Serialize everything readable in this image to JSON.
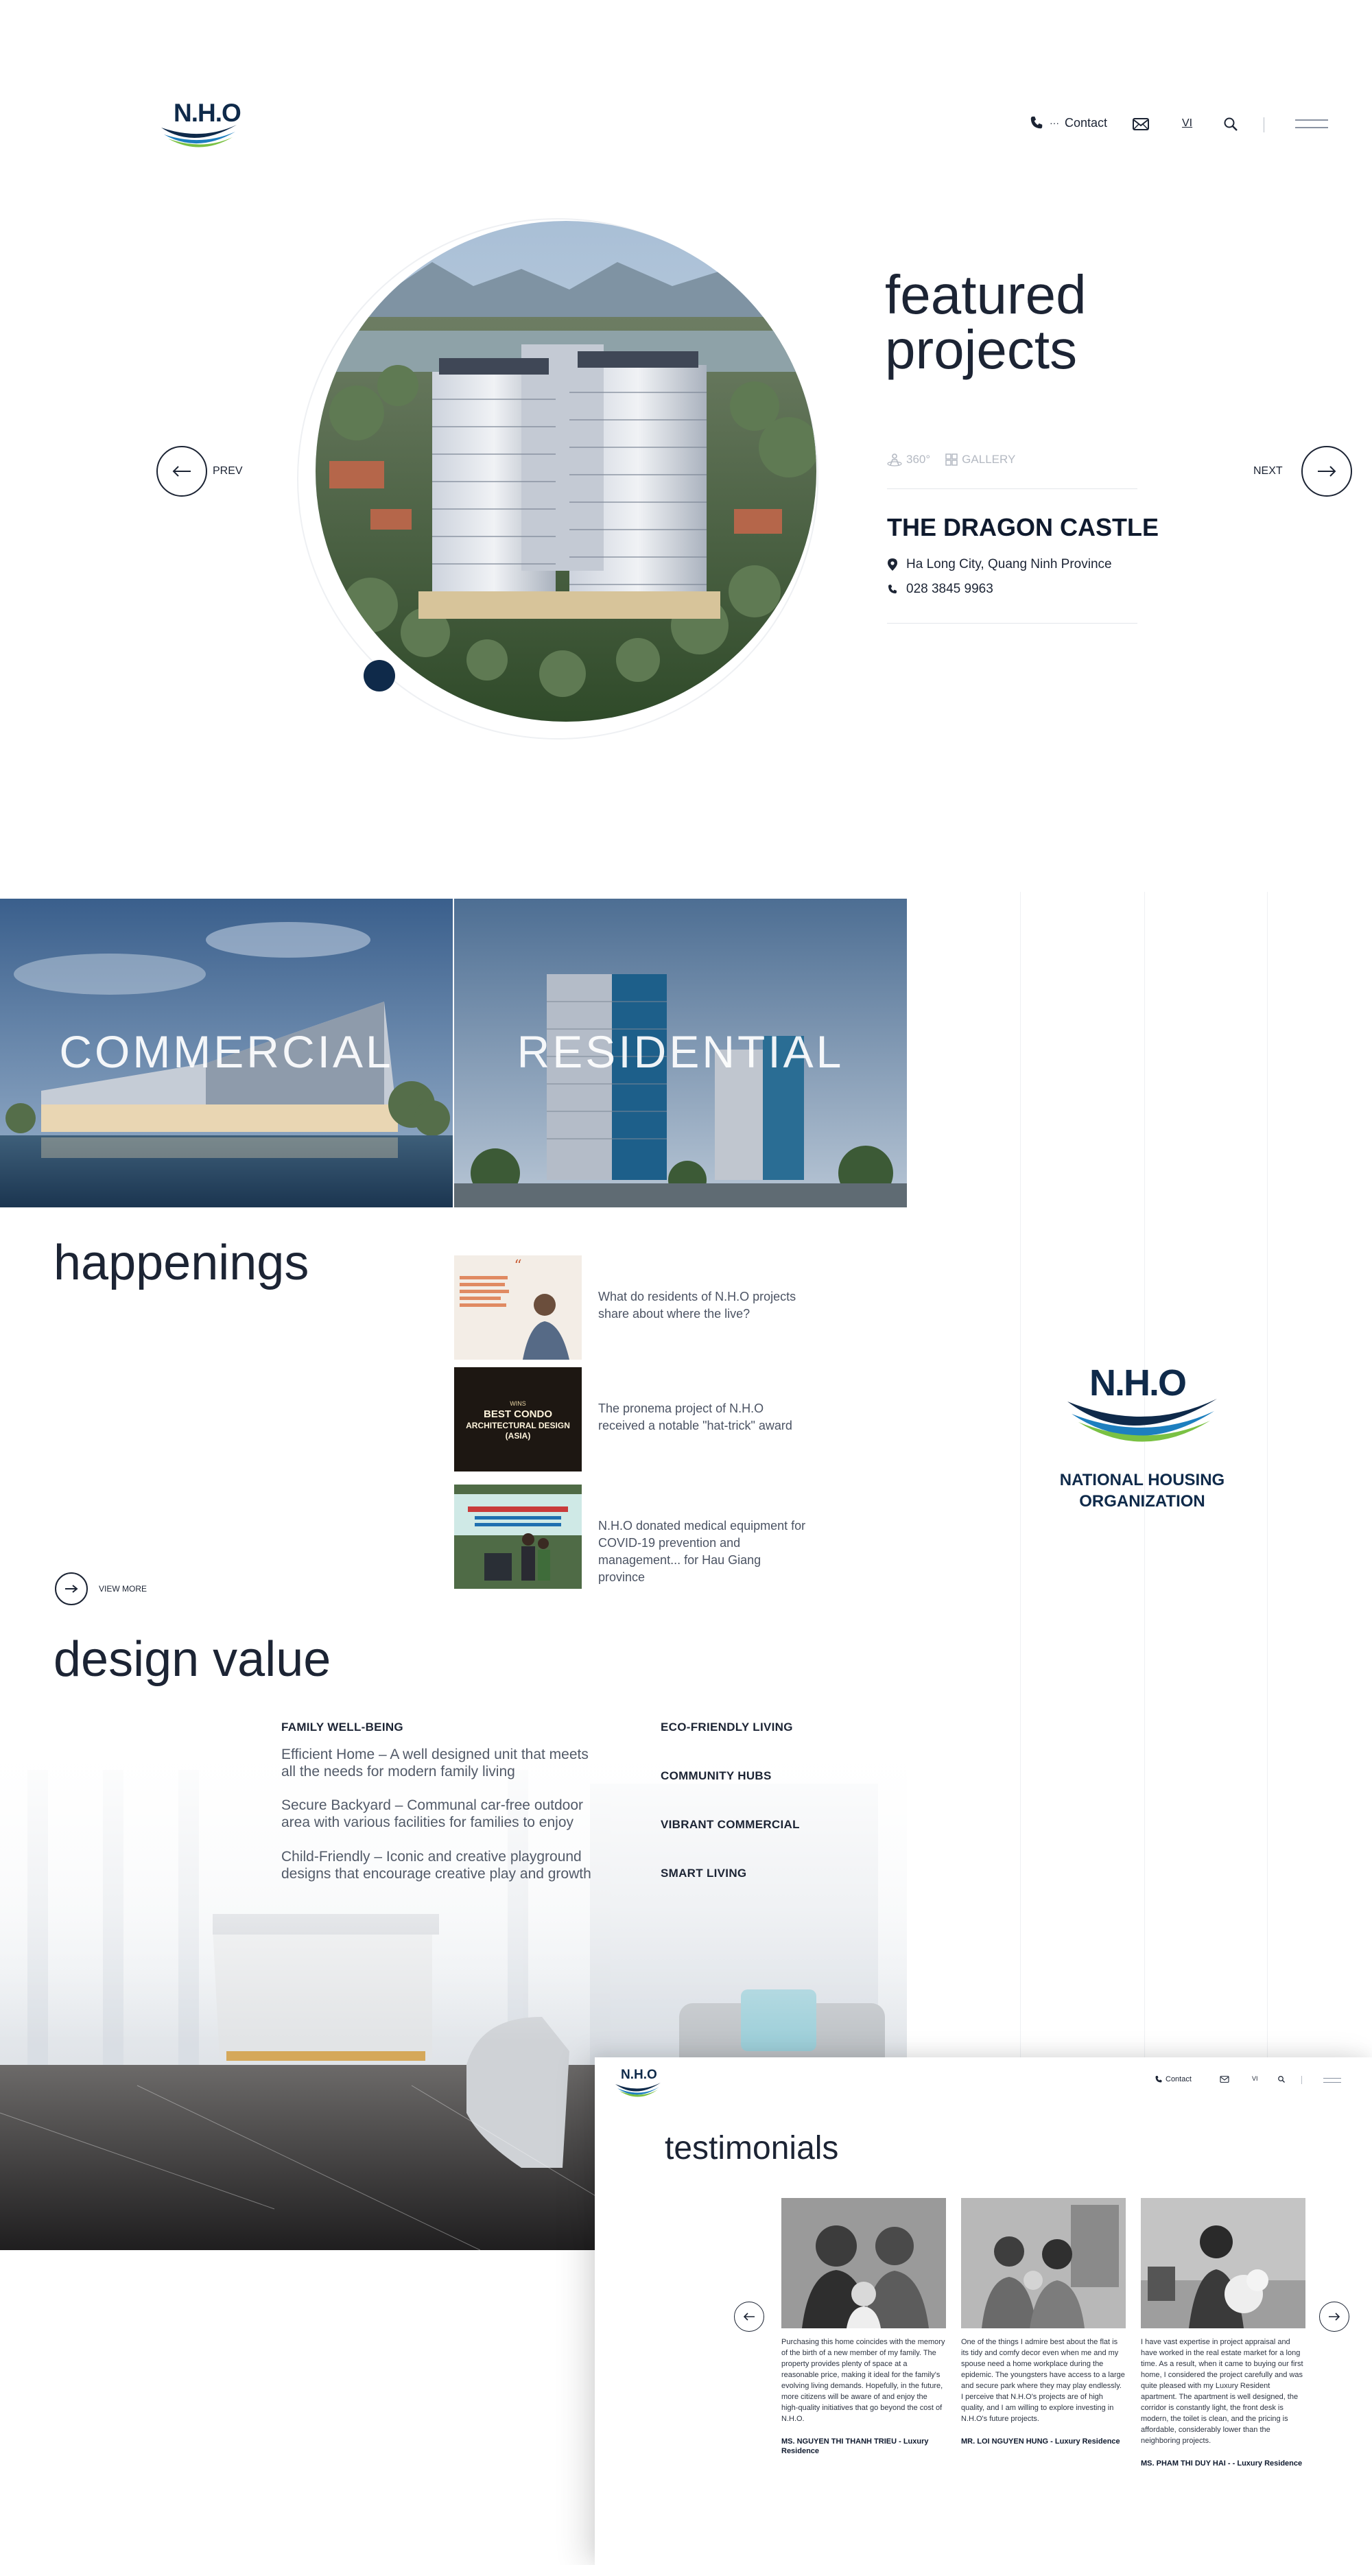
{
  "header": {
    "logo_text": "N.H.O",
    "contact_label": "Contact",
    "language": "VI"
  },
  "featured": {
    "title_line1": "featured",
    "title_line2": "projects",
    "prev_label": "PREV",
    "next_label": "NEXT",
    "tool_360": "360°",
    "tool_gallery": "GALLERY",
    "project_name": "THE DRAGON CASTLE",
    "location": "Ha Long City, Quang Ninh Province",
    "phone": "028 3845 9963"
  },
  "categories": [
    {
      "label": "COMMERCIAL"
    },
    {
      "label": "RESIDENTIAL"
    }
  ],
  "happenings": {
    "title": "happenings",
    "view_more": "VIEW MORE",
    "items": [
      {
        "text": "What do residents of N.H.O projects share about where the live?"
      },
      {
        "text": "The pronema project of N.H.O received a notable \"hat-trick\" award",
        "thumb_line1": "WINS",
        "thumb_line2": "BEST CONDO",
        "thumb_line3": "ARCHITECTURAL DESIGN",
        "thumb_line4": "(ASIA)"
      },
      {
        "text": "N.H.O donated medical equipment for COVID-19 prevention and management... for Hau Giang province"
      }
    ]
  },
  "org": {
    "logo_text": "N.H.O",
    "name_line1": "NATIONAL HOUSING",
    "name_line2": "ORGANIZATION"
  },
  "design_value": {
    "title": "design value",
    "left_heading": "FAMILY WELL-BEING",
    "points": [
      "Efficient Home – A well designed unit that meets all the needs for modern family living",
      "Secure Backyard – Communal car-free outdoor area with various facilities for families to enjoy",
      "Child-Friendly – Iconic and creative playground designs that encourage creative play and growth"
    ],
    "right_headings": [
      "ECO-FRIENDLY LIVING",
      "COMMUNITY HUBS",
      "VIBRANT COMMERCIAL",
      "SMART LIVING"
    ]
  },
  "testimonials": {
    "title": "testimonials",
    "nav_contact": "Contact",
    "nav_lang": "VI",
    "logo_text": "N.H.O",
    "items": [
      {
        "text": "Purchasing this home coincides with the memory of the birth of a new member of my family. The property provides plenty of space at a reasonable price, making it ideal for the family's evolving living demands. Hopefully, in the future, more citizens will be aware of and enjoy the high-quality initiatives that go beyond the cost of N.H.O.",
        "name": "MS. NGUYEN THI THANH TRIEU - Luxury Residence"
      },
      {
        "text": "One of the things I admire best about the flat is its tidy and comfy decor even when me and my spouse need a home workplace during the epidemic. The youngsters have access to a large and secure park where they may play endlessly. I perceive that N.H.O's projects are of high quality, and I am willing to explore investing in N.H.O's future projects.",
        "name": "MR. LOI NGUYEN HUNG - Luxury Residence"
      },
      {
        "text": "I have vast expertise in project appraisal and have worked in the real estate market for a long time. As a result, when it came to buying our first home, I considered the project carefully and was quite pleased with my Luxury Resident apartment. The apartment is well designed, the corridor is constantly light, the front desk is modern, the toilet is clean, and the pricing is affordable, considerably lower than the neighboring projects.",
        "name": "MS. PHAM THI DUY HAI - - Luxury Residence"
      }
    ]
  },
  "colors": {
    "navy": "#0f2a4a",
    "brand_blue": "#1d7fbf",
    "brand_green": "#7ac143",
    "text": "#1c2434"
  }
}
